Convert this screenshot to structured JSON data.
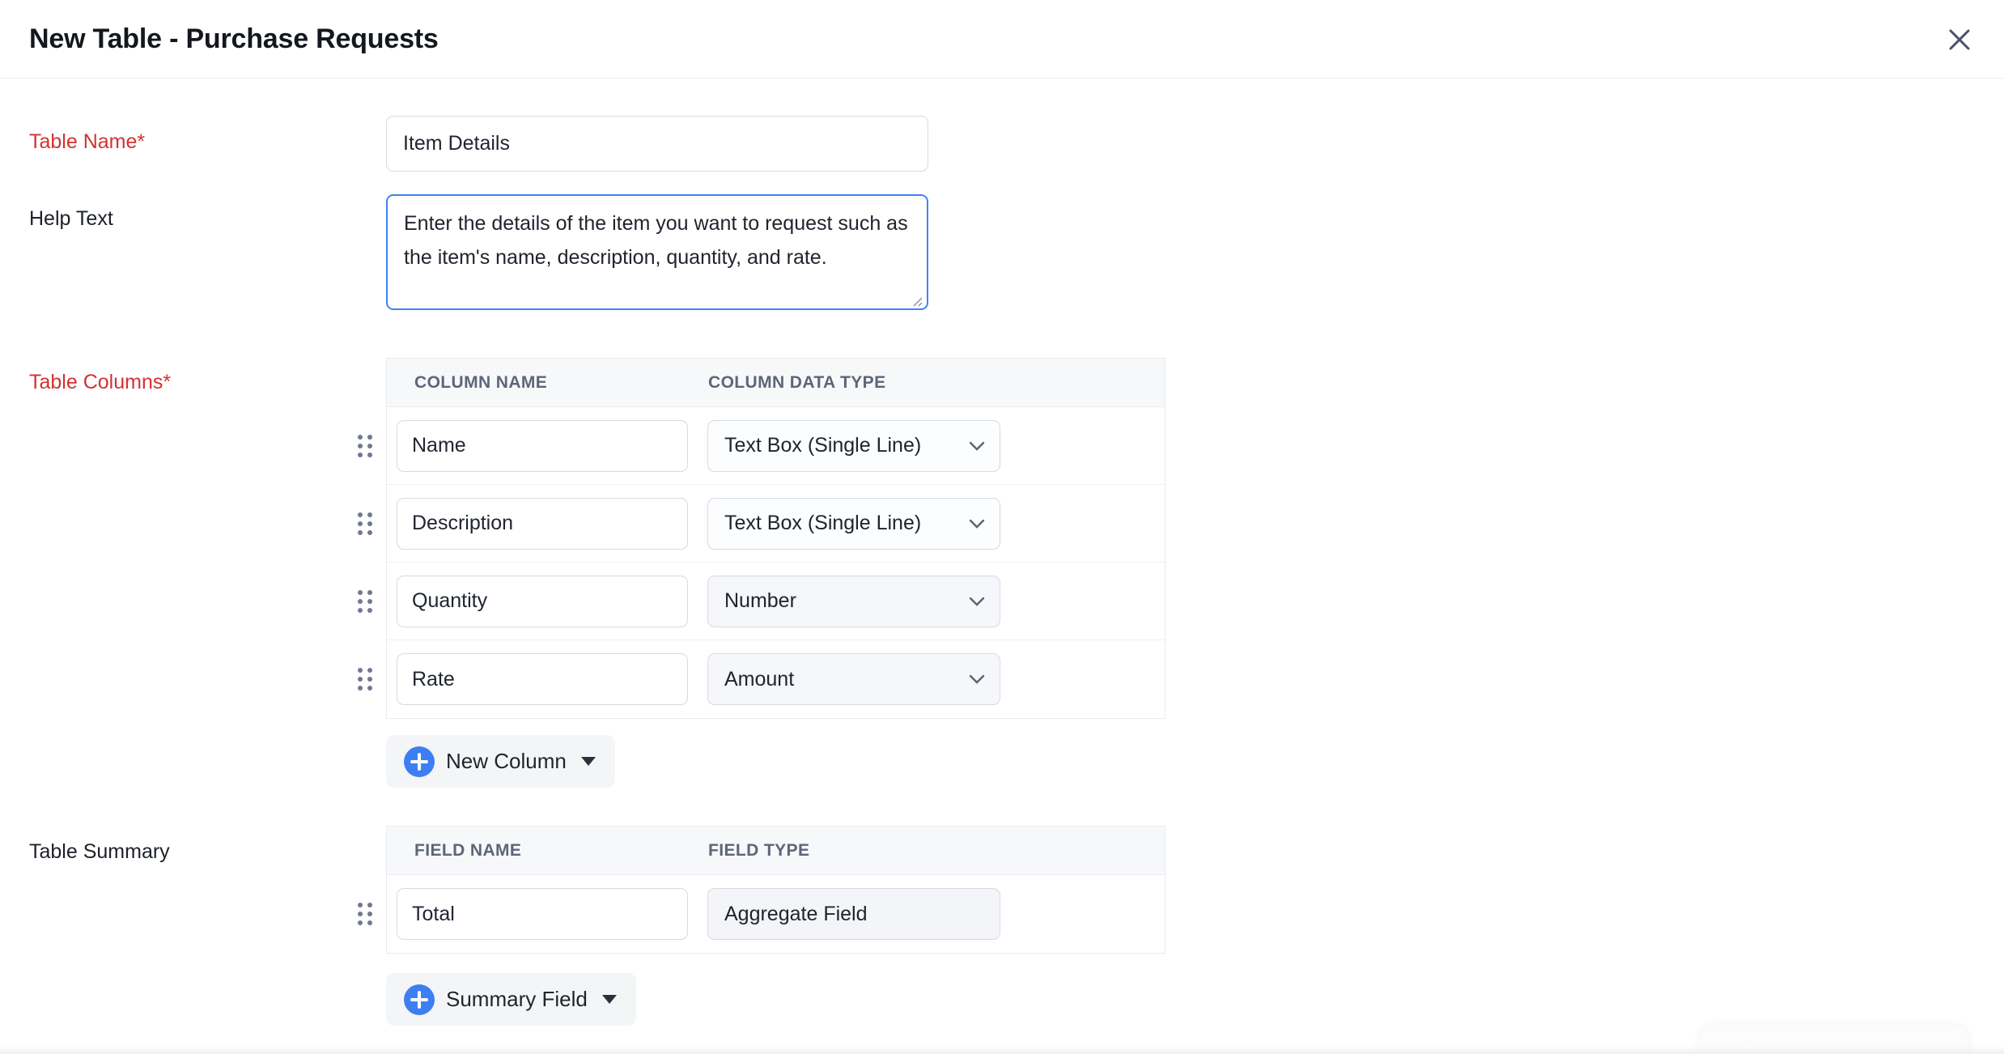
{
  "window": {
    "title": "New Table - Purchase Requests"
  },
  "colors": {
    "required_label_red": "#d43131",
    "accent_blue": "#3d7ff2",
    "focused_field_border": "#3f83f8",
    "table_header_bg": "#f7f8fa",
    "button_bg": "#f4f5f7"
  },
  "icons": {
    "close": "close-icon",
    "plus": "plus-icon",
    "chevron": "chevron-down-icon",
    "caret": "caret-down-icon",
    "drag": "drag-handle-icon",
    "resize": "resize-grip-icon"
  },
  "form": {
    "table_name": {
      "label": "Table Name*",
      "value": "Item Details"
    },
    "help_text": {
      "label": "Help Text",
      "value": "Enter the details of the item you want to request such as the item's name, description, quantity, and rate."
    },
    "table_columns": {
      "label": "Table Columns*",
      "headers": [
        "COLUMN NAME",
        "COLUMN DATA TYPE"
      ],
      "rows": [
        {
          "column_name": "Name",
          "column_data_type": "Text Box (Single Line)"
        },
        {
          "column_name": "Description",
          "column_data_type": "Text Box (Single Line)"
        },
        {
          "column_name": "Quantity",
          "column_data_type": "Number"
        },
        {
          "column_name": "Rate",
          "column_data_type": "Amount"
        }
      ],
      "add_button_label": "New Column"
    },
    "table_summary": {
      "label": "Table Summary",
      "headers": [
        "FIELD NAME",
        "FIELD TYPE"
      ],
      "rows": [
        {
          "field_name": "Total",
          "field_type": "Aggregate Field"
        }
      ],
      "add_button_label": "Summary Field"
    }
  }
}
